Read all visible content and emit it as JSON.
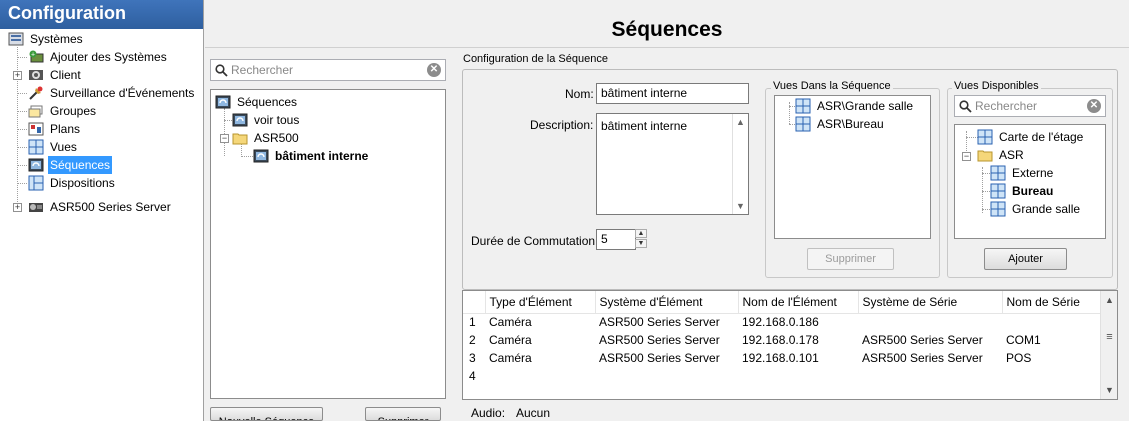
{
  "sidebar": {
    "header": "Configuration",
    "items": [
      {
        "label": "Systèmes",
        "icon": "systems-icon"
      },
      {
        "label": "Ajouter des Systèmes",
        "icon": "add-system-icon"
      },
      {
        "label": "Client",
        "icon": "client-icon"
      },
      {
        "label": "Surveillance d'Événements",
        "icon": "event-monitor-icon"
      },
      {
        "label": "Groupes",
        "icon": "groups-icon"
      },
      {
        "label": "Plans",
        "icon": "plans-icon"
      },
      {
        "label": "Vues",
        "icon": "views-icon"
      },
      {
        "label": "Séquences",
        "icon": "sequences-icon",
        "selected": true
      },
      {
        "label": "Dispositions",
        "icon": "layouts-icon"
      },
      {
        "label": "ASR500 Series Server",
        "icon": "server-icon"
      }
    ]
  },
  "page_title": "Séquences",
  "sequence_tree": {
    "search_placeholder": "Rechercher",
    "items": [
      {
        "label": "Séquences"
      },
      {
        "label": "voir tous"
      },
      {
        "label": "ASR500"
      },
      {
        "label": "bâtiment interne",
        "bold": true
      }
    ],
    "new_button": "Nouvelle Séquence",
    "delete_button": "Supprimer"
  },
  "config": {
    "group_title": "Configuration de la Séquence",
    "name_label": "Nom:",
    "name_value": "bâtiment interne",
    "description_label": "Description:",
    "description_value": "bâtiment interne",
    "dwell_label": "Durée de Commutation:",
    "dwell_value": "5"
  },
  "views_in_sequence": {
    "title": "Vues Dans la Séquence",
    "items": [
      "ASR\\Grande salle",
      "ASR\\Bureau"
    ],
    "remove_button": "Supprimer"
  },
  "available_views": {
    "title": "Vues Disponibles",
    "search_placeholder": "Rechercher",
    "items": [
      {
        "label": "Carte de l'étage"
      },
      {
        "label": "ASR"
      },
      {
        "label": "Externe"
      },
      {
        "label": "Bureau",
        "bold": true
      },
      {
        "label": "Grande salle"
      }
    ],
    "add_button": "Ajouter"
  },
  "table": {
    "columns": [
      "Type d'Élément",
      "Système d'Élément",
      "Nom de l'Élément",
      "Système de Série",
      "Nom de Série"
    ],
    "rows": [
      {
        "num": "1",
        "type": "Caméra",
        "system": "ASR500 Series Server",
        "name": "192.168.0.186",
        "serial_system": "",
        "serial_name": ""
      },
      {
        "num": "2",
        "type": "Caméra",
        "system": "ASR500 Series Server",
        "name": "192.168.0.178",
        "serial_system": "ASR500 Series Server",
        "serial_name": "COM1"
      },
      {
        "num": "3",
        "type": "Caméra",
        "system": "ASR500 Series Server",
        "name": "192.168.0.101",
        "serial_system": "ASR500 Series Server",
        "serial_name": "POS"
      },
      {
        "num": "4",
        "type": "",
        "system": "",
        "name": "",
        "serial_system": "",
        "serial_name": ""
      }
    ]
  },
  "audio": {
    "label": "Audio:",
    "value": "Aucun"
  },
  "colors": {
    "header_blue": "#3f74bb",
    "selection_blue": "#3399ff"
  }
}
